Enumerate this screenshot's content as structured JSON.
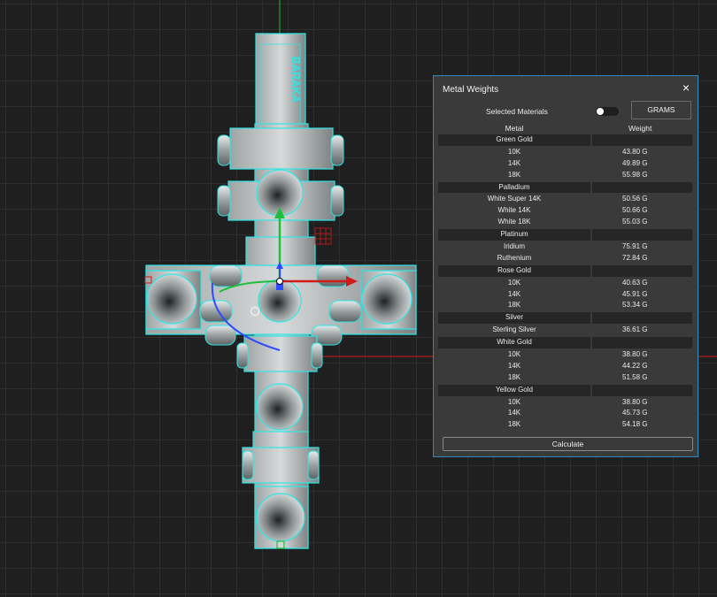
{
  "panel": {
    "title": "Metal Weights",
    "close_icon": "×",
    "selected_materials_label": "Selected Materials",
    "unit_button": "GRAMS",
    "col_metal": "Metal",
    "col_weight": "Weight",
    "calculate_label": "Calculate",
    "toggle_on": false
  },
  "model": {
    "engraving": "BARAKA"
  },
  "groups": [
    {
      "name": "Green Gold",
      "items": [
        {
          "metal": "10K",
          "weight": "43.80 G"
        },
        {
          "metal": "14K",
          "weight": "49.89 G"
        },
        {
          "metal": "18K",
          "weight": "55.98 G"
        }
      ]
    },
    {
      "name": "Palladium",
      "items": [
        {
          "metal": "White Super 14K",
          "weight": "50.56 G"
        },
        {
          "metal": "White 14K",
          "weight": "50.66 G"
        },
        {
          "metal": "White 18K",
          "weight": "55.03 G"
        }
      ]
    },
    {
      "name": "Platinum",
      "items": [
        {
          "metal": "Iridium",
          "weight": "75.91 G"
        },
        {
          "metal": "Ruthenium",
          "weight": "72.84 G"
        }
      ]
    },
    {
      "name": "Rose Gold",
      "items": [
        {
          "metal": "10K",
          "weight": "40.63 G"
        },
        {
          "metal": "14K",
          "weight": "45.91 G"
        },
        {
          "metal": "18K",
          "weight": "53.34 G"
        }
      ]
    },
    {
      "name": "Silver",
      "items": [
        {
          "metal": "Sterling Silver",
          "weight": "36.61 G"
        }
      ]
    },
    {
      "name": "White Gold",
      "items": [
        {
          "metal": "10K",
          "weight": "38.80 G"
        },
        {
          "metal": "14K",
          "weight": "44.22 G"
        },
        {
          "metal": "18K",
          "weight": "51.58 G"
        }
      ]
    },
    {
      "name": "Yellow Gold",
      "items": [
        {
          "metal": "10K",
          "weight": "38.80 G"
        },
        {
          "metal": "14K",
          "weight": "45.73 G"
        },
        {
          "metal": "18K",
          "weight": "54.18 G"
        }
      ]
    }
  ],
  "colors": {
    "wire": "#2ee6e6",
    "panel_bg": "#3a3a3a",
    "panel_border": "#2f88b5",
    "axis_x": "#d11a1a",
    "axis_y": "#1fbf3a",
    "gizmo_z": "#2a4bff"
  }
}
